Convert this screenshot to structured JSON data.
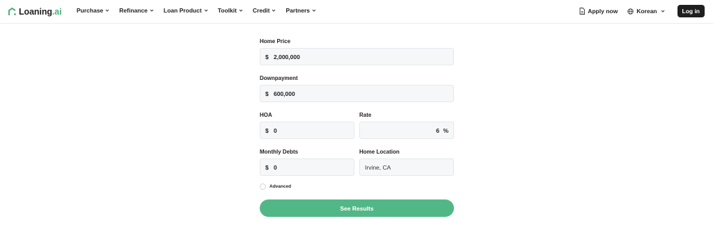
{
  "brand": {
    "name_main": "Loaning",
    "name_suffix": ".ai",
    "accent": "#4caf7d"
  },
  "nav": {
    "items": [
      {
        "label": "Purchase"
      },
      {
        "label": "Refinance"
      },
      {
        "label": "Loan Product"
      },
      {
        "label": "Toolkit"
      },
      {
        "label": "Credit"
      },
      {
        "label": "Partners"
      }
    ]
  },
  "header_right": {
    "apply_label": "Apply now",
    "language_label": "Korean",
    "login_label": "Log in"
  },
  "form": {
    "home_price": {
      "label": "Home Price",
      "prefix": "$",
      "value": "2,000,000"
    },
    "downpayment": {
      "label": "Downpayment",
      "prefix": "$",
      "value": "600,000"
    },
    "hoa": {
      "label": "HOA",
      "prefix": "$",
      "value": "0"
    },
    "rate": {
      "label": "Rate",
      "value": "6",
      "suffix": "%"
    },
    "monthly_debts": {
      "label": "Monthly Debts",
      "prefix": "$",
      "value": "0"
    },
    "home_location": {
      "label": "Home Location",
      "value": "Irvine, CA"
    },
    "advanced_label": "Advanced",
    "submit_label": "See Results",
    "submit_color": "#52b787"
  }
}
